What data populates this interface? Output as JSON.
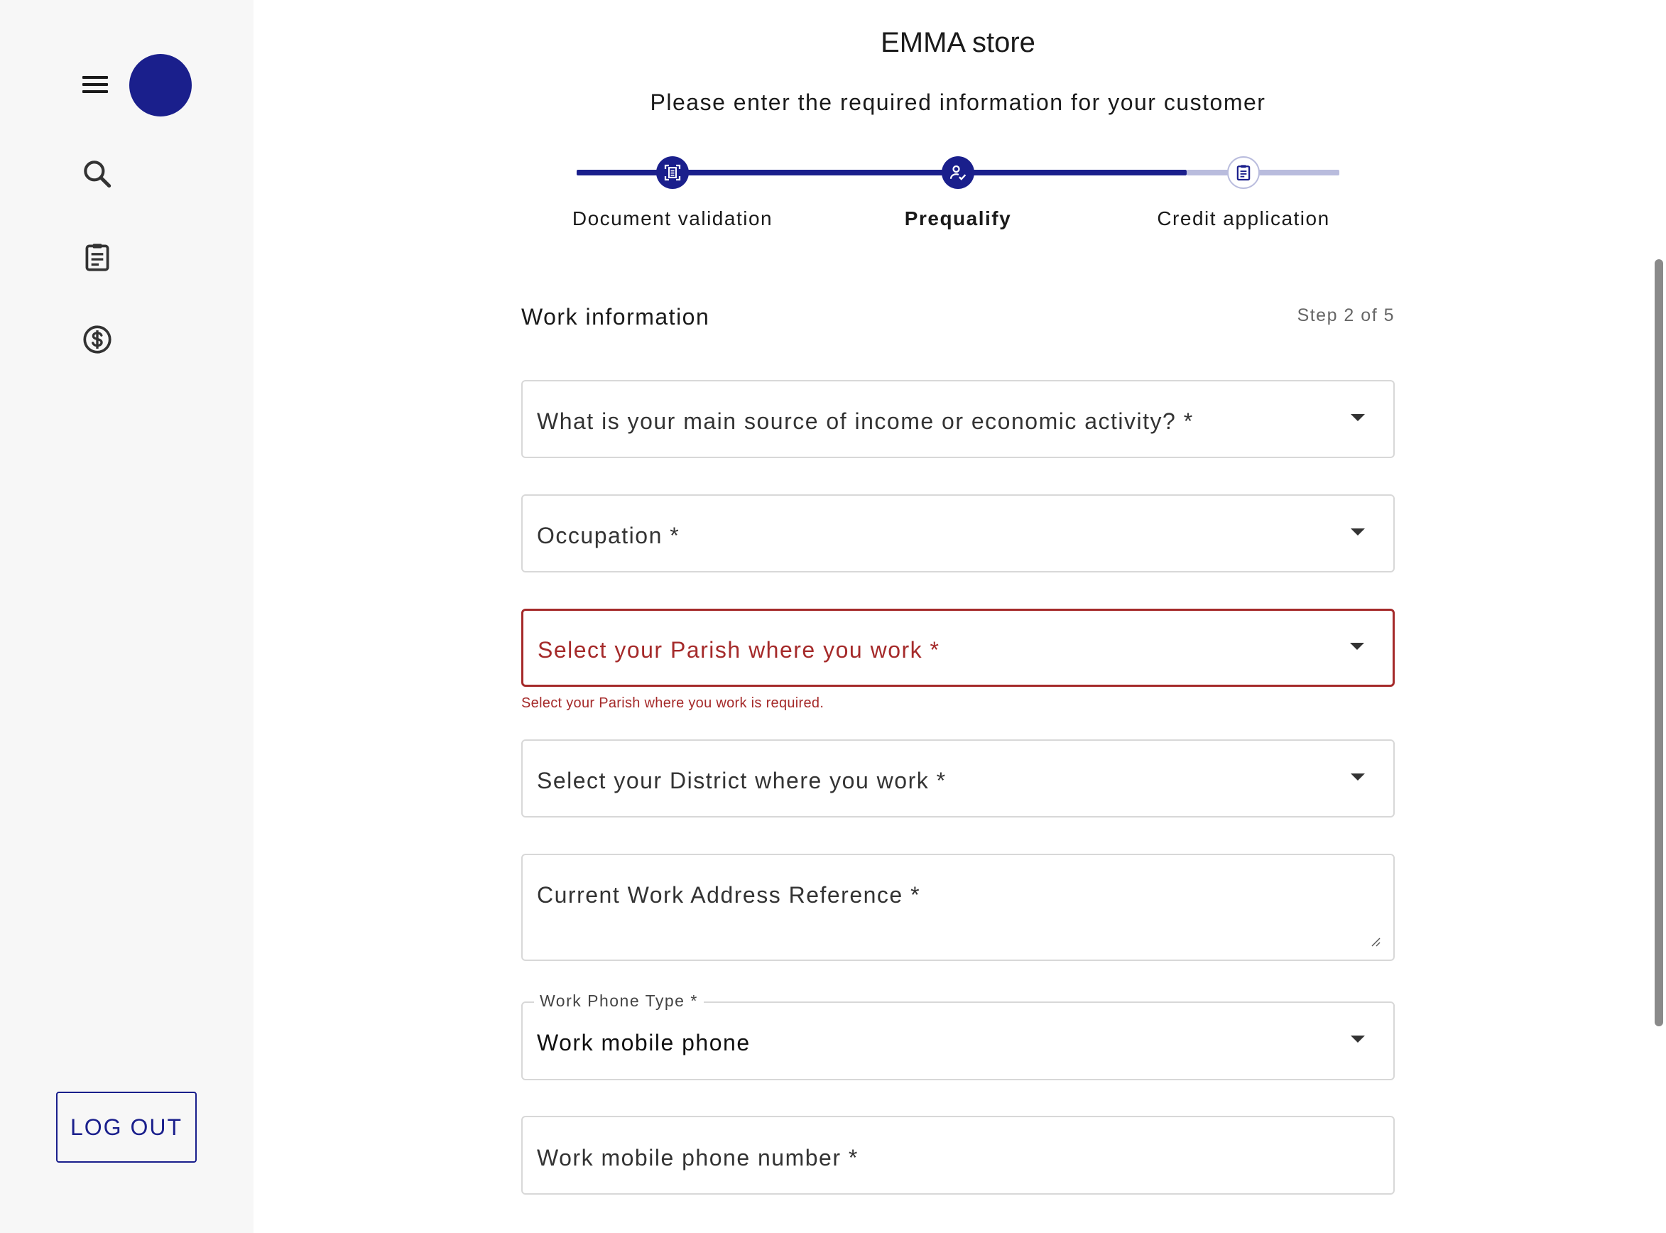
{
  "app": {
    "store_name": "EMMA store",
    "subtitle": "Please enter the required information for your customer"
  },
  "sidebar": {
    "items": [
      {
        "icon": "menu-icon"
      },
      {
        "icon": "search-icon"
      },
      {
        "icon": "clipboard-icon"
      },
      {
        "icon": "dollar-circle-icon"
      }
    ],
    "logout_label": "LOG OUT"
  },
  "stepper": {
    "steps": [
      {
        "label": "Document validation",
        "icon": "document-scan-icon",
        "state": "done"
      },
      {
        "label": "Prequalify",
        "icon": "user-check-icon",
        "state": "current"
      },
      {
        "label": "Credit application",
        "icon": "clipboard-icon",
        "state": "pending"
      }
    ],
    "progress": 0.8
  },
  "form": {
    "section_title": "Work information",
    "step_count": "Step 2 of 5",
    "fields": {
      "income_source": {
        "placeholder": "What is your main source of income or economic activity? *"
      },
      "occupation": {
        "placeholder": "Occupation *"
      },
      "parish": {
        "placeholder": "Select your Parish where you work *",
        "error": "Select your Parish where you work is required."
      },
      "district": {
        "placeholder": "Select your District where you work *"
      },
      "address": {
        "placeholder": "Current Work Address Reference *"
      },
      "phone_type": {
        "label": "Work Phone Type *",
        "value": "Work mobile phone"
      },
      "phone_number": {
        "placeholder": "Work mobile phone number *"
      }
    }
  },
  "colors": {
    "primary": "#1a1f8c",
    "error": "#a52a2a",
    "track_inactive": "#b9bcdd"
  }
}
